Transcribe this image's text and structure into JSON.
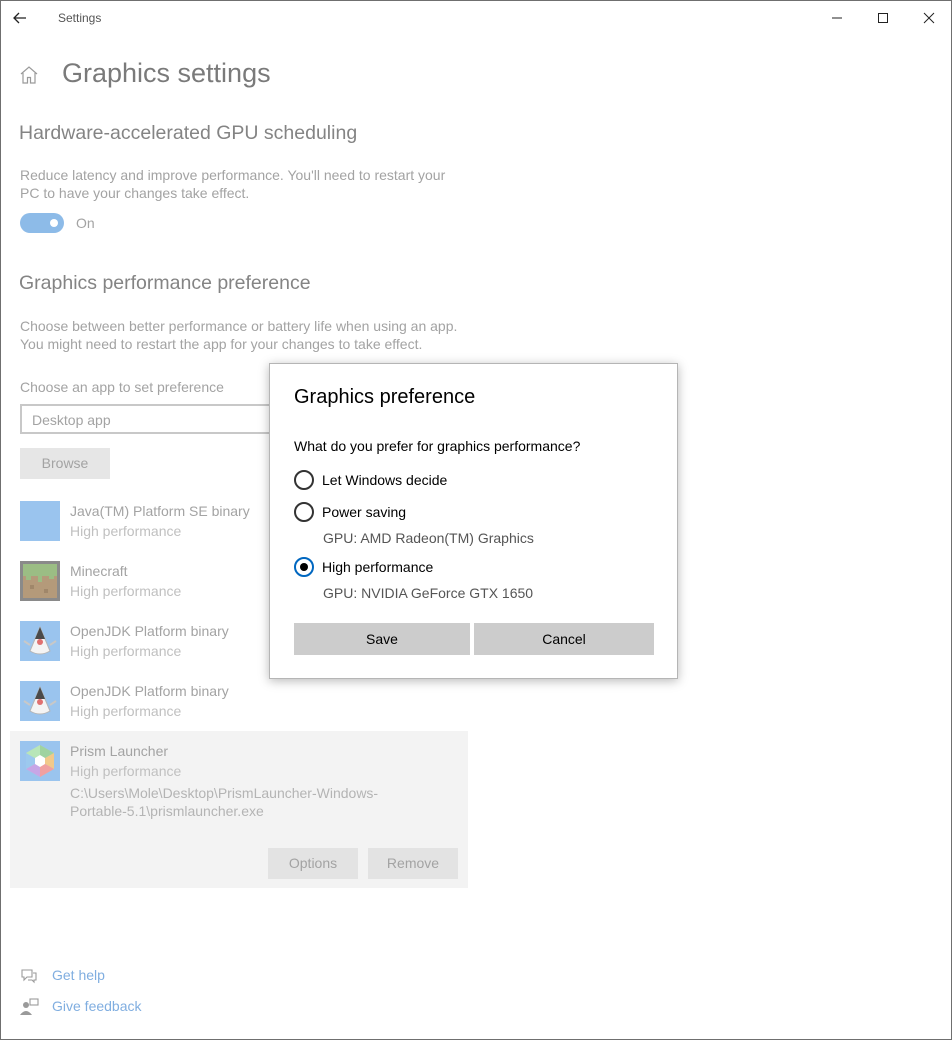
{
  "window": {
    "title": "Settings"
  },
  "page": {
    "title": "Graphics settings"
  },
  "gpu_scheduling": {
    "heading": "Hardware-accelerated GPU scheduling",
    "description_line1": "Reduce latency and improve performance. You'll need to restart your",
    "description_line2": "PC to have your changes take effect.",
    "toggle_state": "On"
  },
  "perf_pref": {
    "heading": "Graphics performance preference",
    "description_line1": "Choose between better performance or battery life when using an app.",
    "description_line2": "You might need to restart the app for your changes to take effect.",
    "choose_label": "Choose an app to set preference",
    "app_type": "Desktop app",
    "browse_label": "Browse"
  },
  "apps": [
    {
      "name": "Java(TM) Platform SE binary",
      "preference": "High performance"
    },
    {
      "name": "Minecraft",
      "preference": "High performance"
    },
    {
      "name": "OpenJDK Platform binary",
      "preference": "High performance"
    },
    {
      "name": "OpenJDK Platform binary",
      "preference": "High performance"
    },
    {
      "name": "Prism Launcher",
      "preference": "High performance",
      "path_line1": "C:\\Users\\Mole\\Desktop\\PrismLauncher-Windows-",
      "path_line2": "Portable-5.1\\prismlauncher.exe",
      "options_label": "Options",
      "remove_label": "Remove"
    }
  ],
  "links": {
    "help": "Get help",
    "feedback": "Give feedback"
  },
  "dialog": {
    "title": "Graphics preference",
    "question": "What do you prefer for graphics performance?",
    "options": [
      {
        "label": "Let Windows decide",
        "gpu": "",
        "selected": false
      },
      {
        "label": "Power saving",
        "gpu": "GPU: AMD Radeon(TM) Graphics",
        "selected": false
      },
      {
        "label": "High performance",
        "gpu": "GPU: NVIDIA GeForce GTX 1650",
        "selected": true
      }
    ],
    "save_label": "Save",
    "cancel_label": "Cancel"
  },
  "colors": {
    "accent": "#0067c0",
    "toggle_on_dimmed": "#8dbbe8",
    "link_dimmed": "#80aee0"
  }
}
